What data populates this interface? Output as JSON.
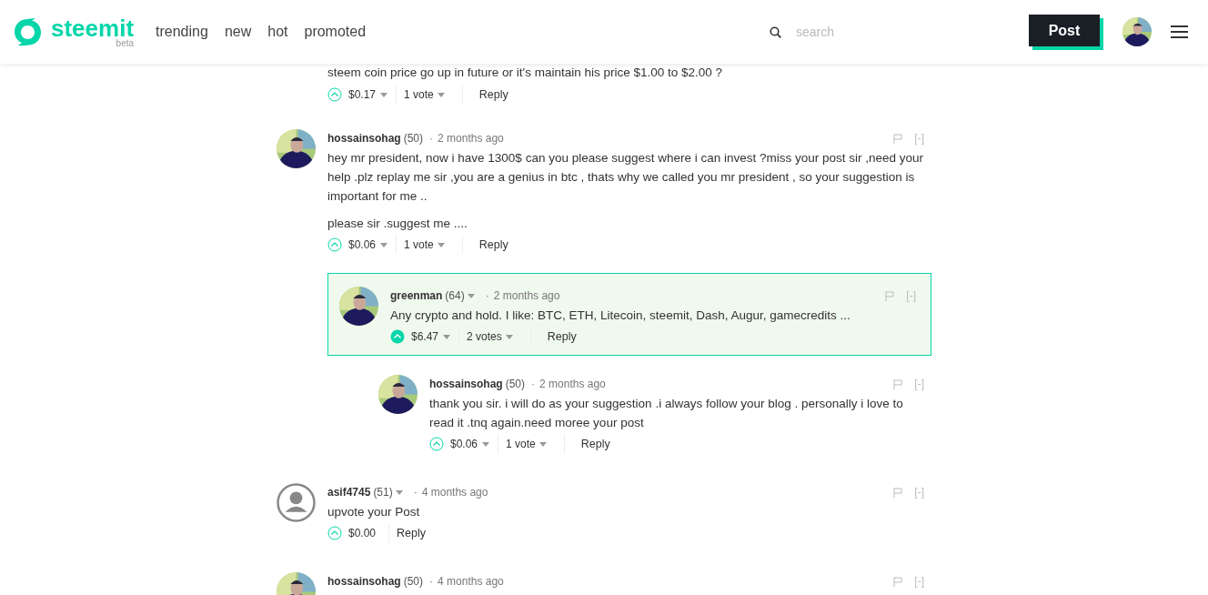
{
  "header": {
    "logo": "steemit",
    "logo_badge": "beta",
    "nav": [
      "trending",
      "new",
      "hot",
      "promoted"
    ],
    "search": {
      "placeholder": "search"
    },
    "post_button": "Post"
  },
  "partial_comment": {
    "body": "steem coin price go up in future or it's maintain his price $1.00 to $2.00 ?",
    "payout": "$0.17",
    "payout_menu": true,
    "votes": "1 vote",
    "upvoted": false,
    "reply": "Reply"
  },
  "comments": [
    {
      "has_photo": true,
      "author": "hossainsohag",
      "reputation": "(50)",
      "author_menu": false,
      "separator": "·",
      "time": "2 months ago",
      "body": [
        "hey mr president, now i have 1300$ can you please suggest where i can invest ?miss your post sir ,need your help .plz replay me sir ,you are a genius in btc , thats why we called you mr president , so your suggestion is important for me ..",
        "please sir .suggest me ...."
      ],
      "payout": "$0.06",
      "payout_menu": true,
      "votes": "1 vote",
      "upvoted": false,
      "highlighted": false,
      "reply": "Reply",
      "collapse": "[-]",
      "children": [
        {
          "has_photo": true,
          "author": "greenman",
          "reputation": "(64)",
          "author_menu": true,
          "separator": "·",
          "time": "2 months ago",
          "body": [
            "Any crypto and hold. I like: BTC, ETH, Litecoin, steemit, Dash, Augur, gamecredits ..."
          ],
          "payout": "$6.47",
          "payout_menu": true,
          "votes": "2 votes",
          "upvoted": true,
          "highlighted": true,
          "reply": "Reply",
          "collapse": "[-]",
          "children": [
            {
              "has_photo": true,
              "author": "hossainsohag",
              "reputation": "(50)",
              "author_menu": false,
              "separator": "·",
              "time": "2 months ago",
              "body": [
                "thank you sir. i will do as your suggestion .i always follow your blog . personally i love to read it .tnq again.need moree your post"
              ],
              "payout": "$0.06",
              "payout_menu": true,
              "votes": "1 vote",
              "upvoted": false,
              "highlighted": false,
              "reply": "Reply",
              "collapse": "[-]"
            }
          ]
        }
      ]
    },
    {
      "has_photo": false,
      "author": "asif4745",
      "reputation": "(51)",
      "author_menu": true,
      "separator": "·",
      "time": "4 months ago",
      "body": [
        "upvote your Post"
      ],
      "payout": "$0.00",
      "payout_menu": false,
      "upvoted": false,
      "highlighted": false,
      "reply": "Reply",
      "collapse": "[-]"
    },
    {
      "has_photo": true,
      "author": "hossainsohag",
      "reputation": "(50)",
      "author_menu": false,
      "separator": "·",
      "time": "4 months ago",
      "collapse": "[-]"
    }
  ]
}
